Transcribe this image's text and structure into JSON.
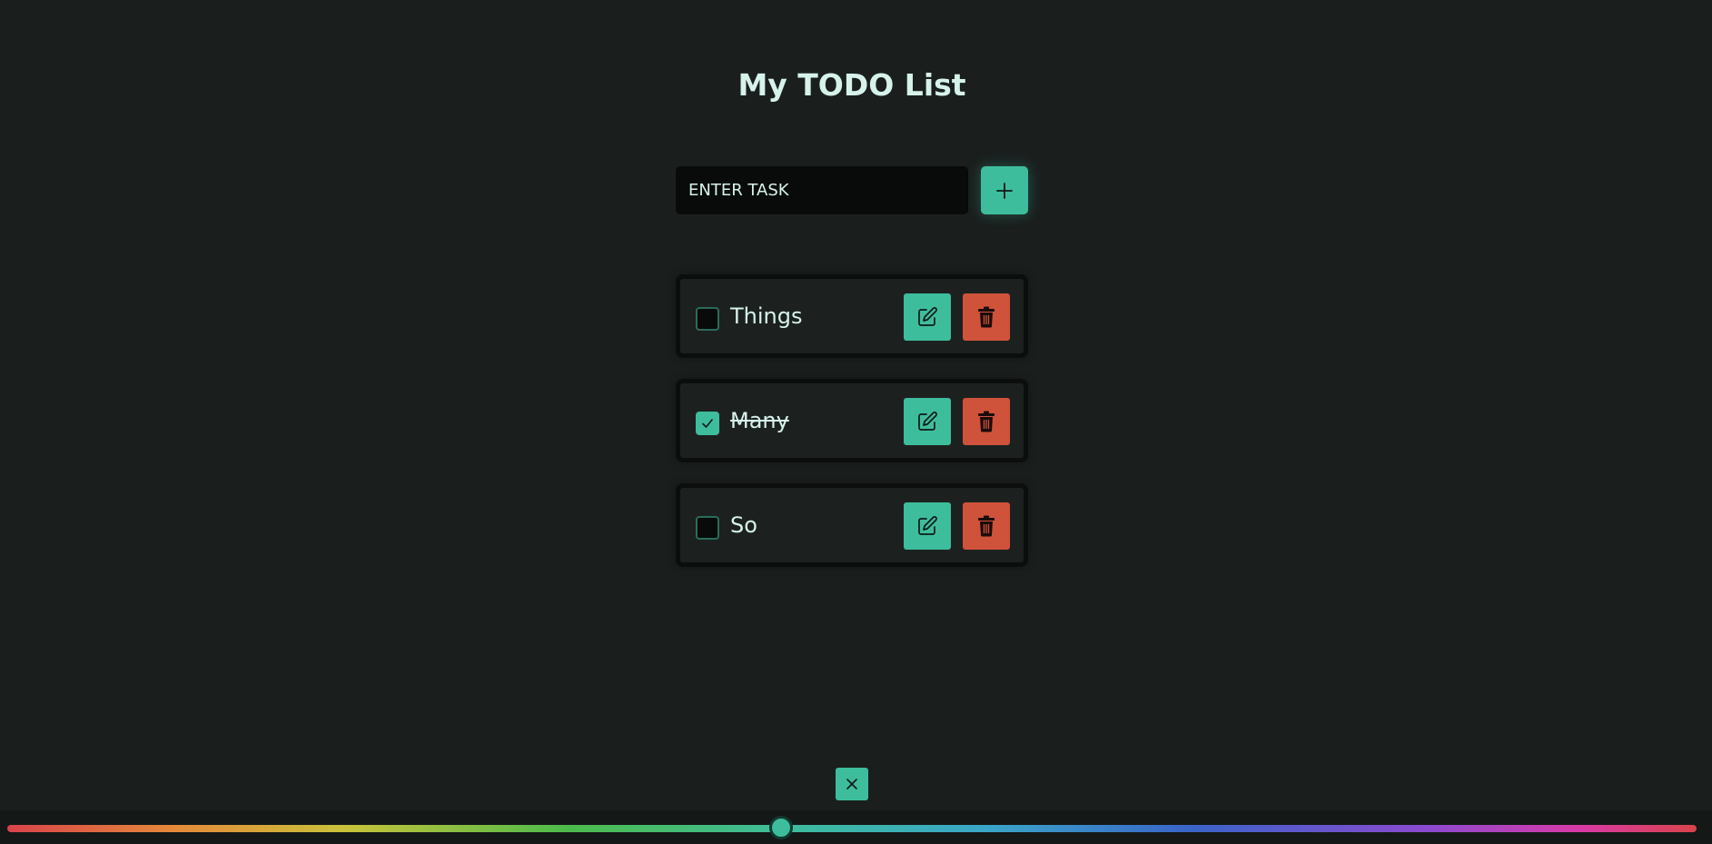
{
  "title": "My TODO List",
  "input": {
    "placeholder": "ENTER TASK",
    "value": ""
  },
  "add_button": {
    "icon": "plus-icon"
  },
  "todos": [
    {
      "text": "Things",
      "checked": false
    },
    {
      "text": "Many",
      "checked": true
    },
    {
      "text": "So",
      "checked": false
    }
  ],
  "item_actions": {
    "edit_icon": "pencil-square-icon",
    "delete_icon": "trash-icon"
  },
  "close_button": {
    "icon": "close-icon"
  },
  "hue_slider": {
    "value_percent": 45.8
  },
  "colors": {
    "background": "#1a1f1e",
    "accent": "#3dbd9c",
    "danger": "#cf523a",
    "text": "#d6f2ea",
    "input_bg": "#080b0a"
  }
}
